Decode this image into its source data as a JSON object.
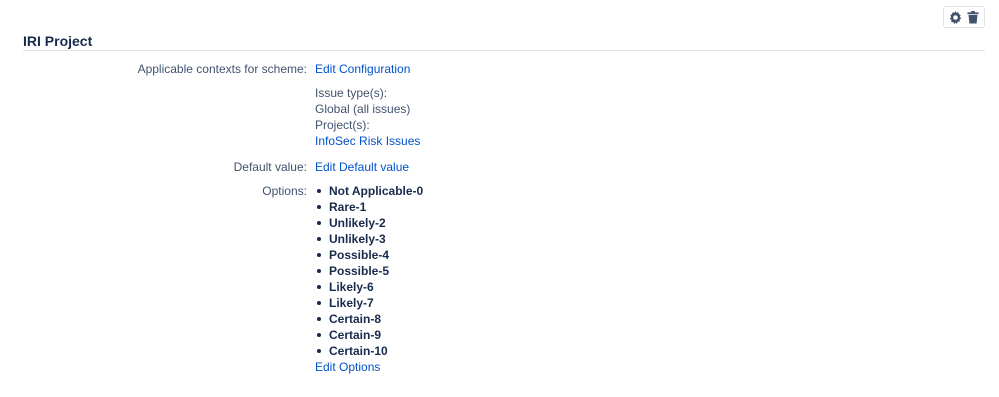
{
  "header": {
    "title": "IRI Project"
  },
  "toolbar": {
    "icons": [
      "gear-icon",
      "trash-icon"
    ]
  },
  "contexts": {
    "label": "Applicable contexts for scheme:",
    "edit_link": "Edit Configuration",
    "issue_types_label": "Issue type(s):",
    "issue_types_value": "Global (all issues)",
    "projects_label": "Project(s):",
    "project_link": "InfoSec Risk Issues"
  },
  "default_value": {
    "label": "Default value:",
    "edit_link": "Edit Default value"
  },
  "options": {
    "label": "Options:",
    "items": [
      "Not Applicable-0",
      "Rare-1",
      "Unlikely-2",
      "Unlikely-3",
      "Possible-4",
      "Possible-5",
      "Likely-6",
      "Likely-7",
      "Certain-8",
      "Certain-9",
      "Certain-10"
    ],
    "edit_link": "Edit Options"
  },
  "colors": {
    "link": "#0052cc",
    "text": "#172b4d",
    "label": "#42526e"
  }
}
